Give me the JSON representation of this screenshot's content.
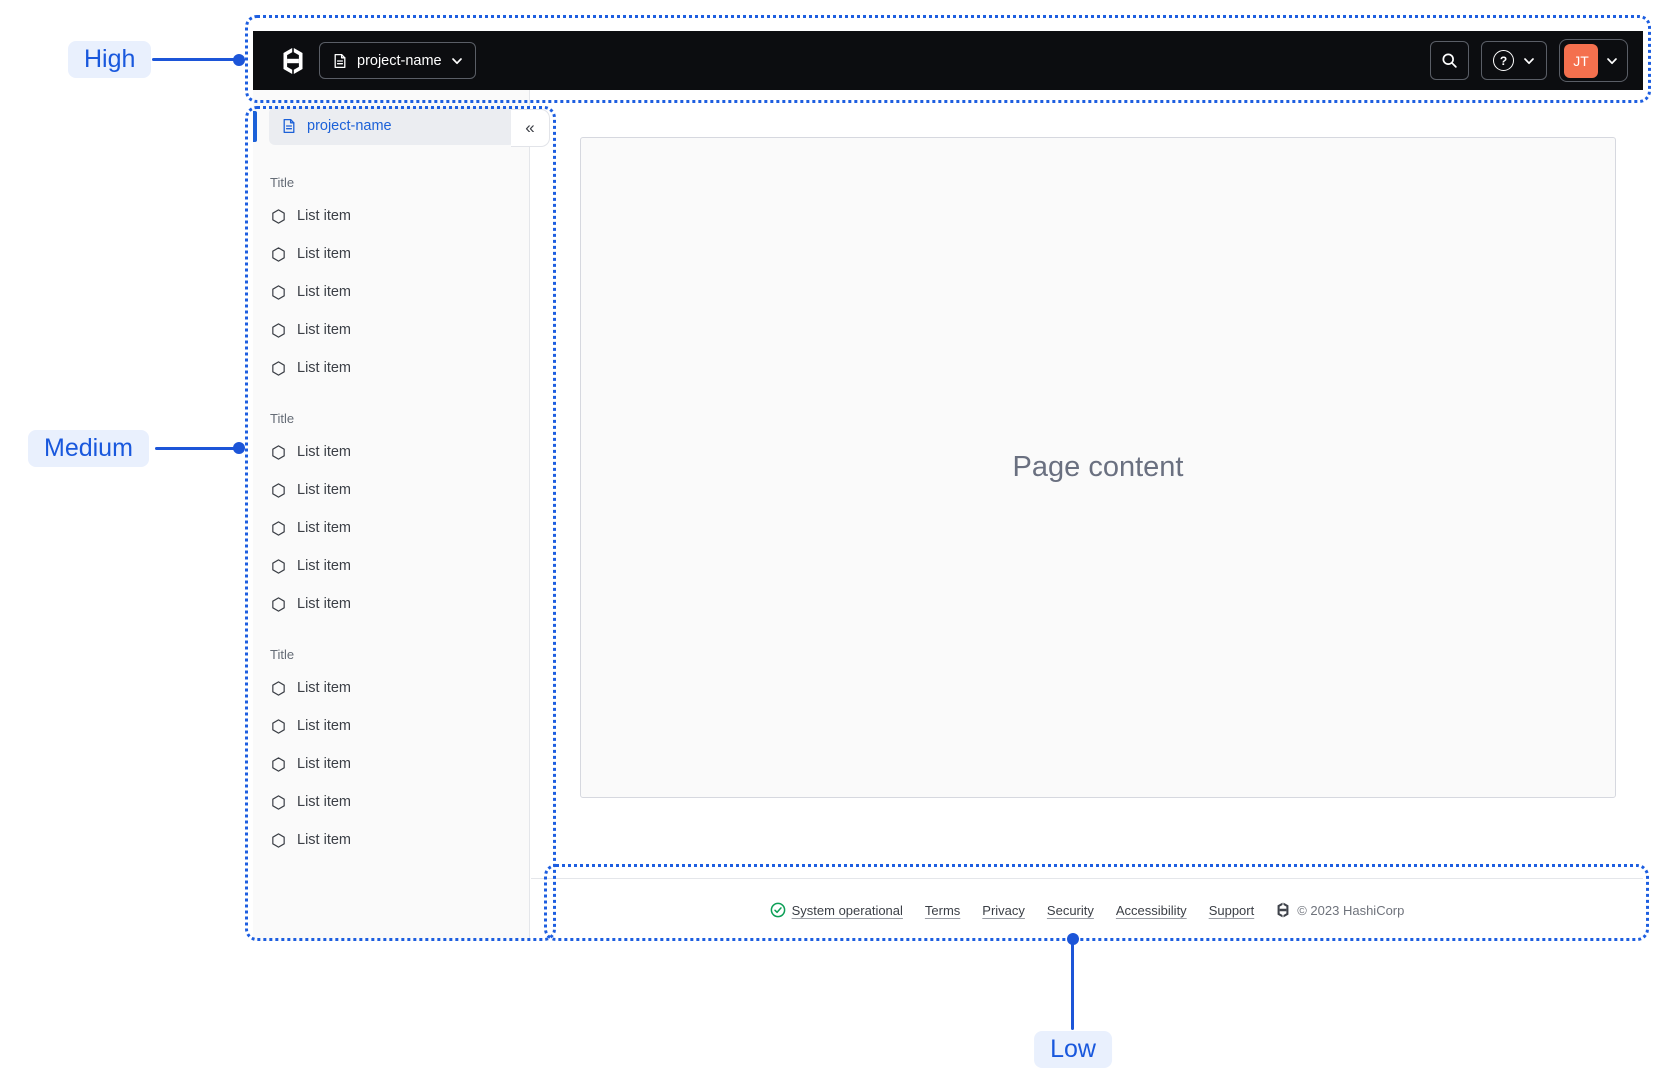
{
  "colors": {
    "accent_blue": "#1d5ee0",
    "connector_blue": "#1c55d8",
    "label_text": "#1958dd",
    "label_bg": "#e9f0fd",
    "nav_bg": "#0c0d10",
    "avatar_orange": "#f4704e",
    "link_blue": "#1c61d8",
    "success_green": "#0c9f56"
  },
  "annotations": {
    "high": "High",
    "medium": "Medium",
    "low": "Low"
  },
  "top_nav": {
    "project_switcher_label": "project-name",
    "user_initials": "JT",
    "help_glyph": "?",
    "icons": {
      "logo": "hashicorp-logo",
      "document": "document-icon",
      "search": "magnifier-icon",
      "help": "question-circle-icon",
      "chevron": "chevron-down-icon"
    }
  },
  "sidebar": {
    "header_label": "project-name",
    "collapse_glyph": "«",
    "sections": [
      {
        "title": "Title",
        "items": [
          "List item",
          "List item",
          "List item",
          "List item",
          "List item"
        ]
      },
      {
        "title": "Title",
        "items": [
          "List item",
          "List item",
          "List item",
          "List item",
          "List item"
        ]
      },
      {
        "title": "Title",
        "items": [
          "List item",
          "List item",
          "List item",
          "List item",
          "List item"
        ]
      }
    ]
  },
  "main": {
    "placeholder": "Page content"
  },
  "footer": {
    "status_label": "System operational",
    "links": [
      "Terms",
      "Privacy",
      "Security",
      "Accessibility",
      "Support"
    ],
    "copyright": "© 2023 HashiCorp"
  }
}
